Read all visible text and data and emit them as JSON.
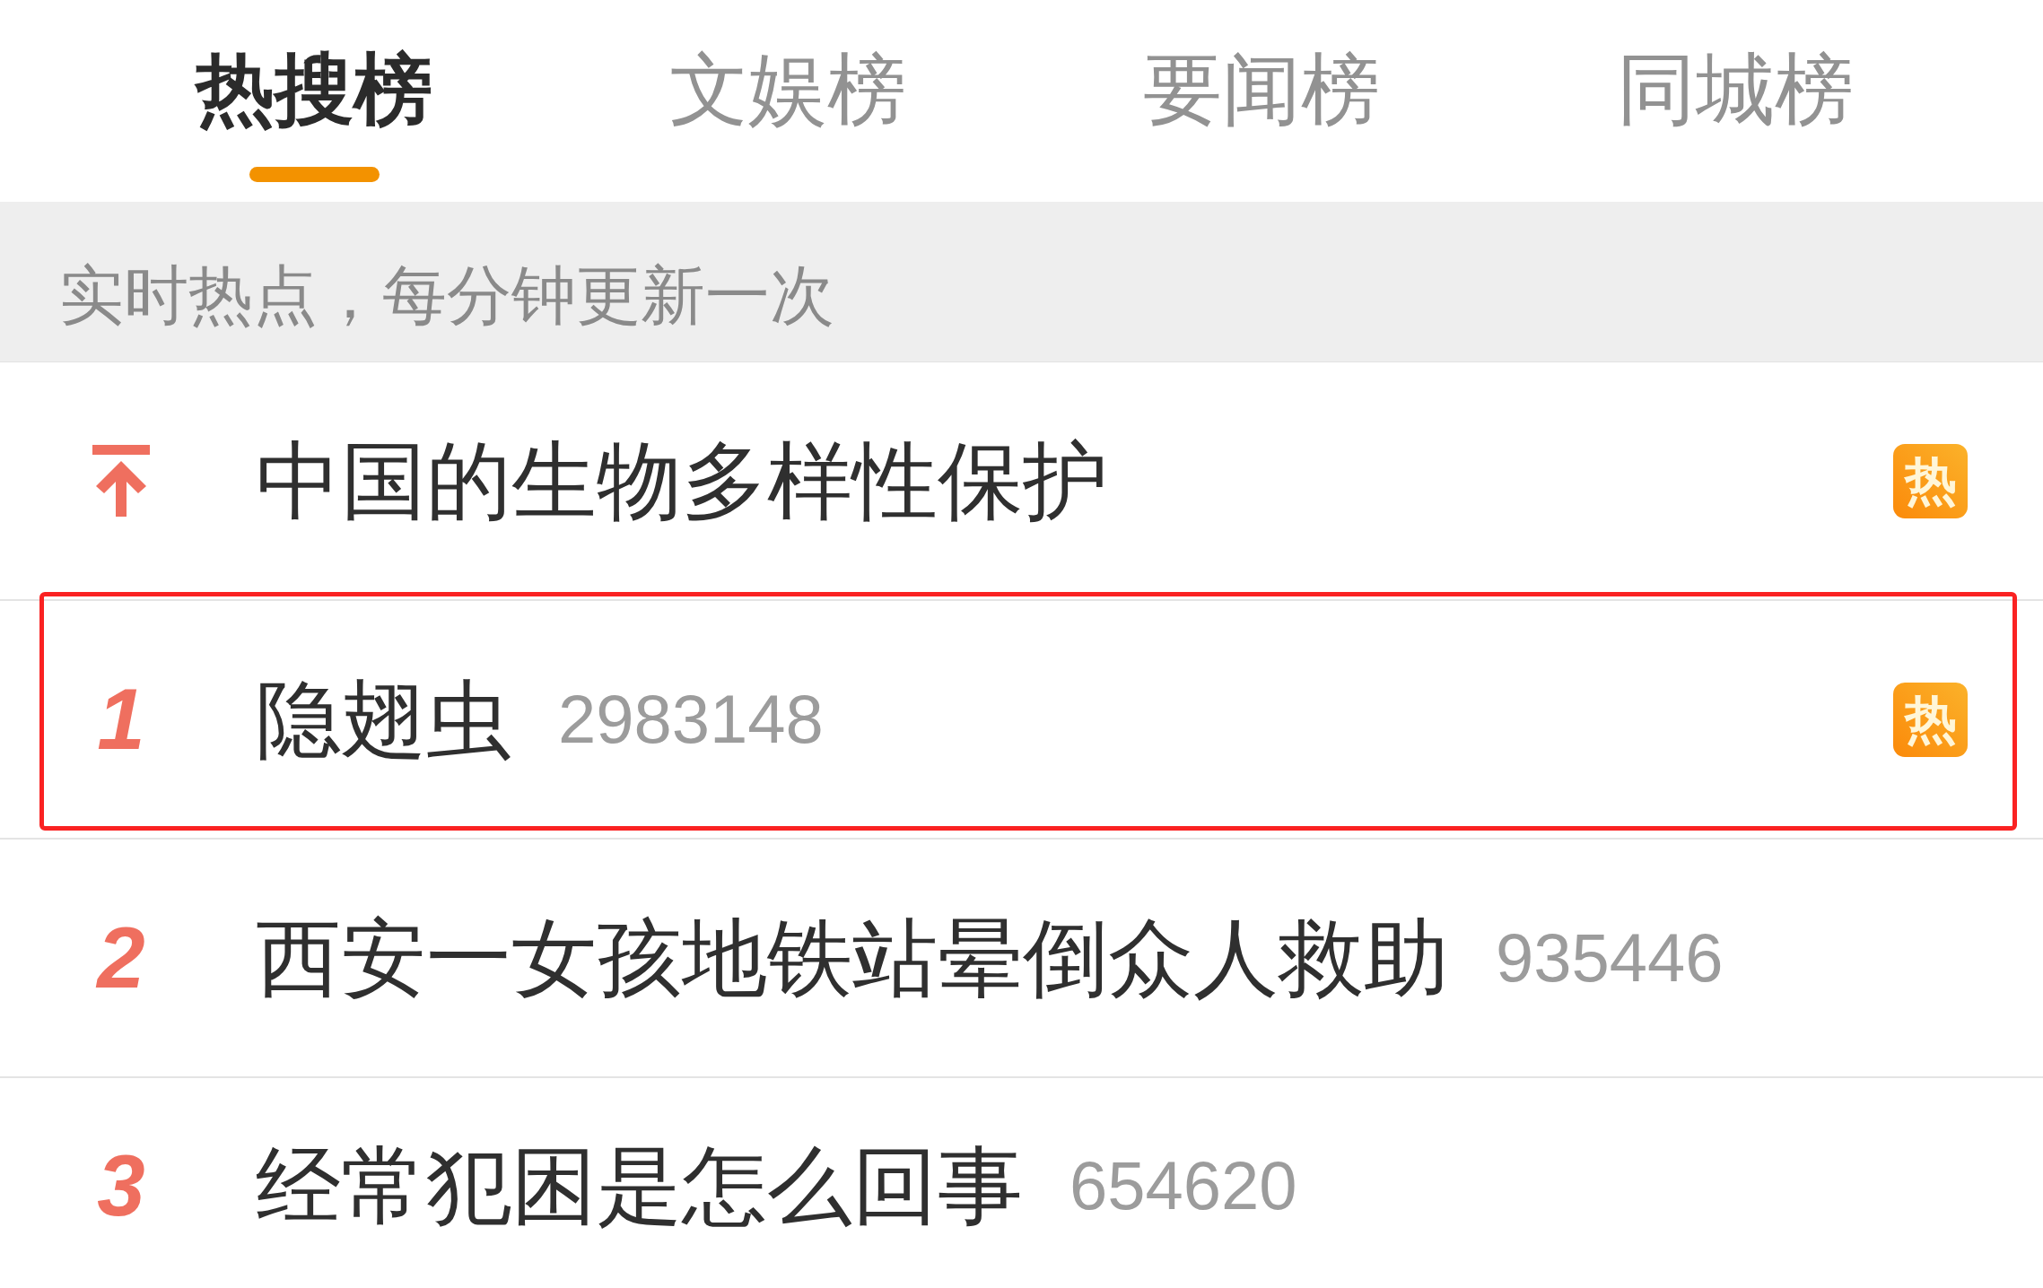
{
  "tabs": [
    {
      "label": "热搜榜",
      "selected": true
    },
    {
      "label": "文娱榜",
      "selected": false
    },
    {
      "label": "要闻榜",
      "selected": false
    },
    {
      "label": "同城榜",
      "selected": false
    }
  ],
  "notice": "实时热点，每分钟更新一次",
  "rows": [
    {
      "kind": "pinned",
      "title": "中国的生物多样性保护",
      "badge": "热",
      "highlighted": false
    },
    {
      "kind": "rank",
      "rank": "1",
      "title": "隐翅虫",
      "count": "2983148",
      "badge": "热",
      "highlighted": true
    },
    {
      "kind": "rank",
      "rank": "2",
      "title": "西安一女孩地铁站晕倒众人救助",
      "count": "935446",
      "highlighted": false
    },
    {
      "kind": "rank",
      "rank": "3",
      "title": "经常犯困是怎么回事",
      "count": "654620",
      "highlighted": false
    }
  ]
}
